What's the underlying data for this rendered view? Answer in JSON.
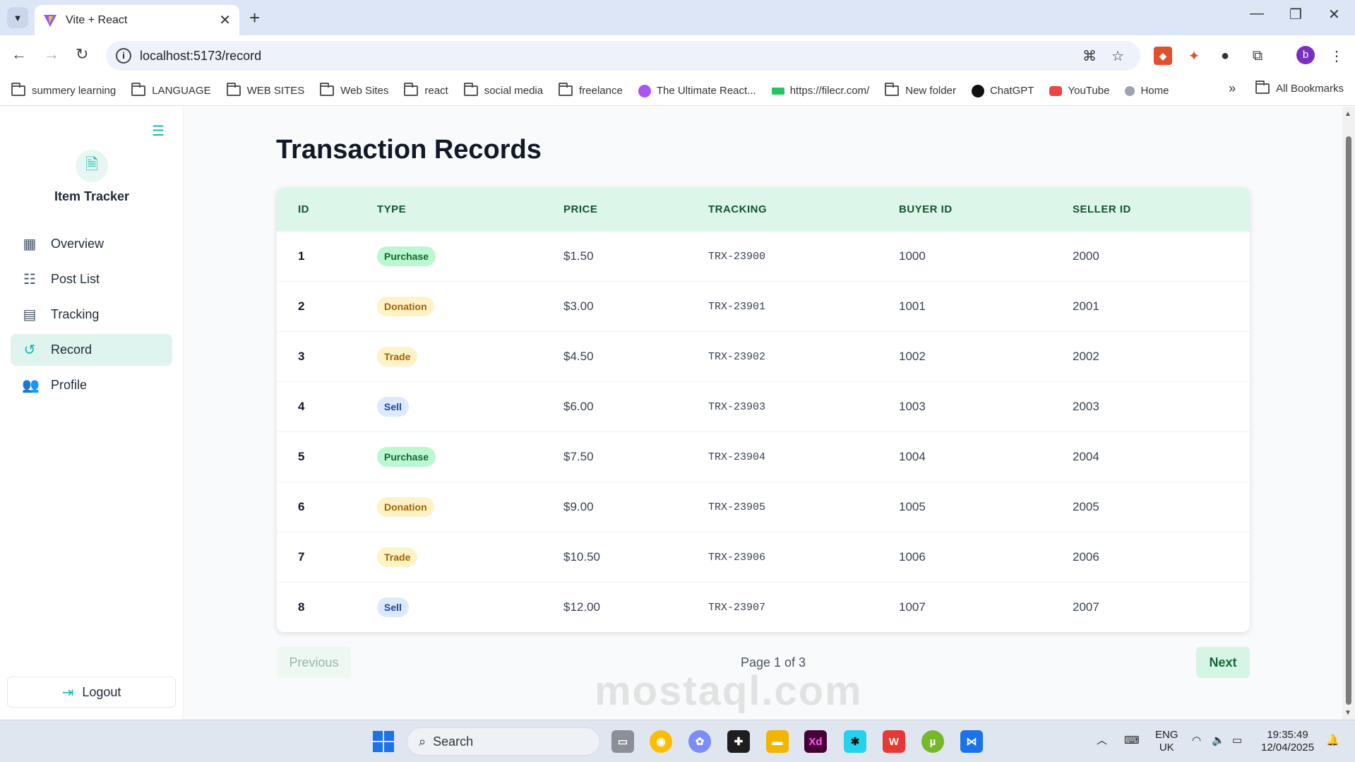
{
  "browser": {
    "tab_title": "Vite + React",
    "url": "localhost:5173/record",
    "profile_initial": "b",
    "bookmarks": [
      "summery learning",
      "LANGUAGE",
      "WEB SITES",
      "Web Sites",
      "react",
      "social media",
      "freelance",
      "The Ultimate React...",
      "https://filecr.com/",
      "New folder",
      "ChatGPT",
      "YouTube",
      "Home"
    ],
    "all_bookmarks": "All Bookmarks"
  },
  "sidebar": {
    "brand": "Item Tracker",
    "items": [
      {
        "label": "Overview",
        "icon": "dashboard-icon"
      },
      {
        "label": "Post List",
        "icon": "list-icon"
      },
      {
        "label": "Tracking",
        "icon": "chat-icon"
      },
      {
        "label": "Record",
        "icon": "history-icon",
        "active": true
      },
      {
        "label": "Profile",
        "icon": "people-icon"
      }
    ],
    "logout": "Logout"
  },
  "main": {
    "title": "Transaction Records",
    "columns": [
      "ID",
      "TYPE",
      "PRICE",
      "TRACKING",
      "BUYER ID",
      "SELLER ID"
    ],
    "rows": [
      {
        "id": "1",
        "type": "Purchase",
        "price": "$1.50",
        "tracking": "TRX-23900",
        "buyer": "1000",
        "seller": "2000"
      },
      {
        "id": "2",
        "type": "Donation",
        "price": "$3.00",
        "tracking": "TRX-23901",
        "buyer": "1001",
        "seller": "2001"
      },
      {
        "id": "3",
        "type": "Trade",
        "price": "$4.50",
        "tracking": "TRX-23902",
        "buyer": "1002",
        "seller": "2002"
      },
      {
        "id": "4",
        "type": "Sell",
        "price": "$6.00",
        "tracking": "TRX-23903",
        "buyer": "1003",
        "seller": "2003"
      },
      {
        "id": "5",
        "type": "Purchase",
        "price": "$7.50",
        "tracking": "TRX-23904",
        "buyer": "1004",
        "seller": "2004"
      },
      {
        "id": "6",
        "type": "Donation",
        "price": "$9.00",
        "tracking": "TRX-23905",
        "buyer": "1005",
        "seller": "2005"
      },
      {
        "id": "7",
        "type": "Trade",
        "price": "$10.50",
        "tracking": "TRX-23906",
        "buyer": "1006",
        "seller": "2006"
      },
      {
        "id": "8",
        "type": "Sell",
        "price": "$12.00",
        "tracking": "TRX-23907",
        "buyer": "1007",
        "seller": "2007"
      }
    ],
    "pagination": {
      "previous": "Previous",
      "page_info": "Page 1 of 3",
      "next": "Next"
    }
  },
  "taskbar": {
    "search": "Search",
    "lang1": "ENG",
    "lang2": "UK",
    "time": "19:35:49",
    "date": "12/04/2025",
    "watermark": "mostaql.com"
  },
  "colors": {
    "accent": "#14b8a6",
    "header_bg": "#dcf7ea",
    "active_nav": "#dff4ee"
  }
}
